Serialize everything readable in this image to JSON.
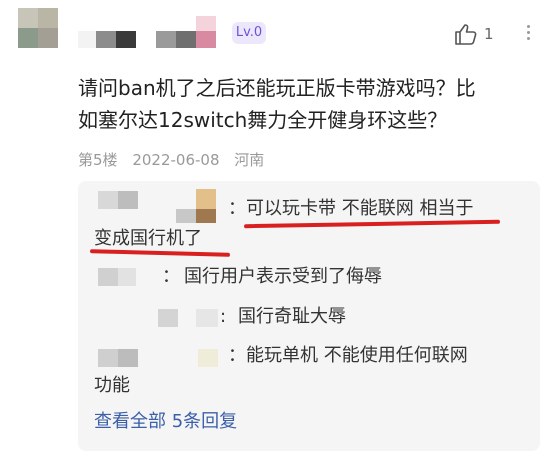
{
  "comment": {
    "level_badge": "Lv.0",
    "like_count": "1",
    "text_line1": "请问ban机了之后还能玩正版卡带游戏吗？比",
    "text_line2": "如塞尔达12switch舞力全开健身环这些？",
    "floor": "第5楼",
    "date": "2022-06-08",
    "location": "河南"
  },
  "replies": [
    {
      "prefix": "：",
      "text_line1": "可以玩卡带 不能联网 相当于",
      "text_line2": "变成国行机了"
    },
    {
      "prefix": "：",
      "text_line1": "国行用户表示受到了侮辱"
    },
    {
      "prefix": ":",
      "text_line1": "国行奇耻大辱"
    },
    {
      "prefix": "：",
      "text_line1": "能玩单机 不能使用任何联网",
      "text_line2": "功能"
    }
  ],
  "view_all": "查看全部 5条回复",
  "colors": {
    "accent": "#6b52d9",
    "link": "#3b5fa8",
    "highlight": "#d92020"
  }
}
